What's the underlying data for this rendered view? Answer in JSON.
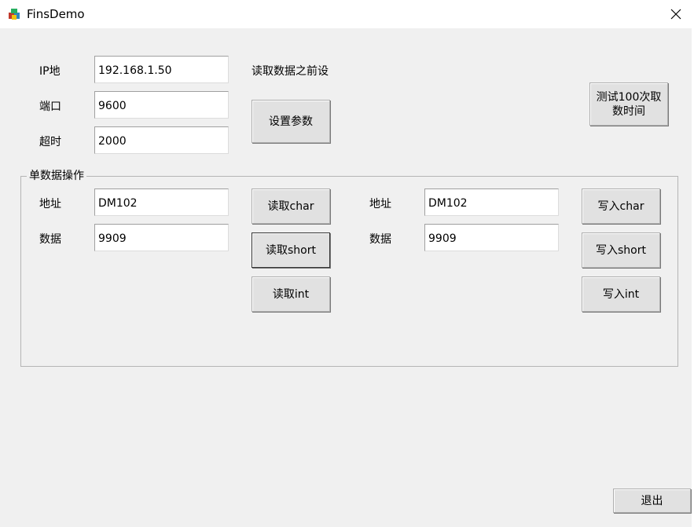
{
  "window": {
    "title": "FinsDemo",
    "icon": "app-icon",
    "close_icon": "close-icon"
  },
  "connection": {
    "ip_label": "IP地",
    "ip_value": "192.168.1.50",
    "port_label": "端口",
    "port_value": "9600",
    "timeout_label": "超时",
    "timeout_value": "2000",
    "hint": "读取数据之前设",
    "set_params_button": "设置参数",
    "test_button": "测试100次取数时间"
  },
  "single_data": {
    "group_title": "单数据操作",
    "read": {
      "address_label": "地址",
      "address_value": "DM102",
      "data_label": "数据",
      "data_value": "9909",
      "read_char_button": "读取char",
      "read_short_button": "读取short",
      "read_int_button": "读取int"
    },
    "write": {
      "address_label": "地址",
      "address_value": "DM102",
      "data_label": "数据",
      "data_value": "9909",
      "write_char_button": "写入char",
      "write_short_button": "写入short",
      "write_int_button": "写入int"
    }
  },
  "exit_button": "退出"
}
